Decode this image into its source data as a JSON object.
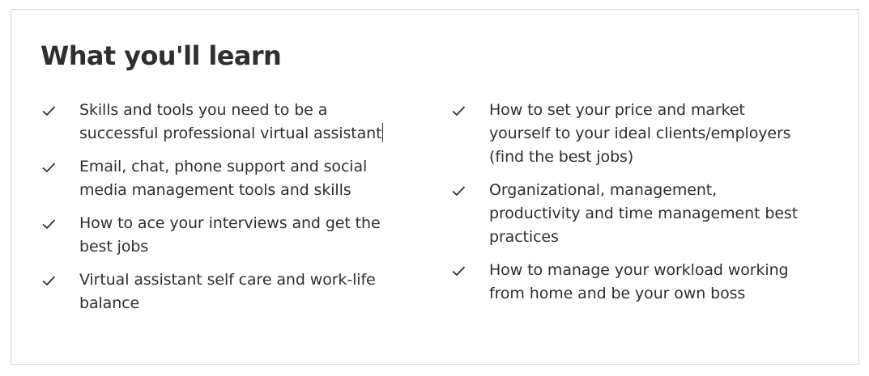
{
  "section": {
    "title": "What you'll learn"
  },
  "left_items": [
    {
      "text": "Skills and tools you need to be a successful professional virtual assistant"
    },
    {
      "text": "Email, chat, phone support and social media management tools and skills"
    },
    {
      "text": "How to ace your interviews and get the best jobs"
    },
    {
      "text": "Virtual assistant self care and work-life balance"
    }
  ],
  "right_items": [
    {
      "text": "How to set your price and market yourself to your ideal clients/employers (find the best jobs)"
    },
    {
      "text": "Organizational, management, productivity and time management best practices"
    },
    {
      "text": "How to manage your workload working from home and be your own boss"
    }
  ],
  "icons": {
    "item_icon": "check-icon"
  },
  "colors": {
    "text": "#2d2f31",
    "border": "#d1d7dc"
  }
}
